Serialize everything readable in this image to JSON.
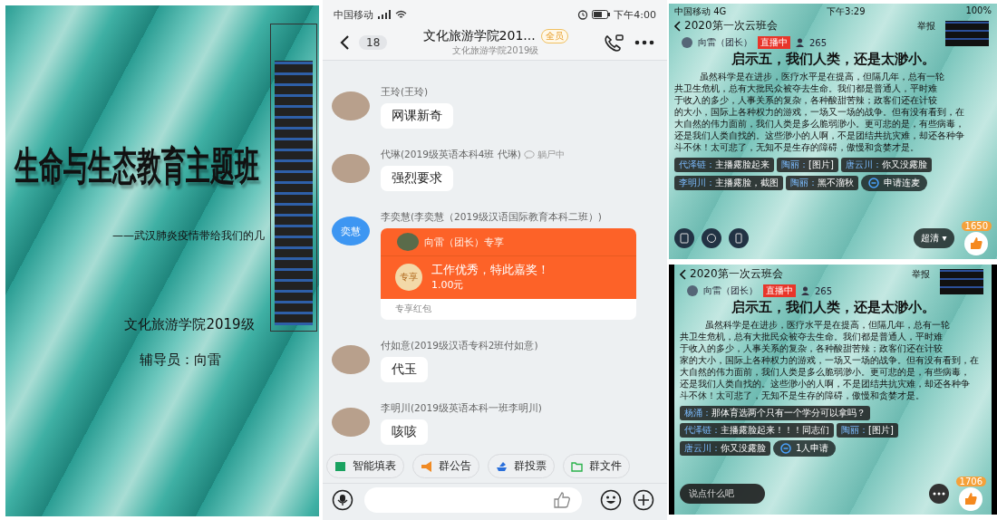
{
  "slide": {
    "title": "生命与生态教育主题班",
    "subtitle": "——武汉肺炎疫情带给我们的几",
    "college": "文化旅游学院2019级",
    "counselor": "辅导员：向雷"
  },
  "chat": {
    "status_bar": {
      "carrier": "中国移动",
      "time": "下午4:00"
    },
    "header": {
      "back_count": "18",
      "title": "文化旅游学院201...",
      "badge": "全员",
      "subtitle": "文化旅游学院2019级"
    },
    "messages": [
      {
        "kind": "text",
        "sender": "王玲(王玲)",
        "text": "网课新奇"
      },
      {
        "kind": "text",
        "sender": "代琳(2019级英语本科4班 代琳)",
        "status": "躺尸中",
        "text": "强烈要求"
      },
      {
        "kind": "red_packet",
        "sender": "李奕慧(李奕慧（2019级汉语国际教育本科二班）)",
        "avatar_text": "奕慧",
        "packet": {
          "from": "向雷（团长）专享",
          "badge": "专享",
          "wish": "工作优秀，特此嘉奖！",
          "amount": "1.00元",
          "footer": "专享红包"
        }
      },
      {
        "kind": "text",
        "sender": "付如意(2019级汉语专科2班付如意)",
        "text": "代玉"
      },
      {
        "kind": "text",
        "sender": "李明川(2019级英语本科一班李明川)",
        "text": "咳咳"
      }
    ],
    "quick_actions": [
      {
        "kind": "form",
        "label": "智能填表"
      },
      {
        "kind": "notice",
        "label": "群公告"
      },
      {
        "kind": "vote",
        "label": "群投票"
      },
      {
        "kind": "file",
        "label": "群文件"
      }
    ]
  },
  "streams": [
    {
      "status_bar": {
        "carrier": "中国移动",
        "network": "4G",
        "time": "下午3:29",
        "battery": "100%"
      },
      "title": "2020第一次云班会",
      "host": "向雷（团长）",
      "live_badge": "直播中",
      "viewers": "265",
      "report": "举报",
      "heading": "启示五，我们人类，还是太渺小。",
      "lines": [
        "虽然科学是在进步，医疗水平是在提高，但隔几年，总有一轮",
        "共卫生危机，总有大批民众被夺去生命。我们都是普通人，平时难",
        "于收入的多少，人事关系的复杂，各种酸甜苦辣；政客们还在计较",
        "的大小，国际上各种权力的游戏，一场又一场的战争。但有没有看到，在",
        "大自然的伟力面前，我们人类是多么脆弱渺小。更可悲的是，有些病毒，",
        "还是我们人类自找的。这些渺小的人啊，不是团结共抗灾难，却还各种争",
        "斗不休！太可悲了，无知不是生存的障碍，傲慢和贪婪才是。"
      ],
      "comments": [
        {
          "name": "代泽链：",
          "text": "主播露脸起来"
        },
        {
          "name": "陶丽：",
          "text": "[图片]"
        },
        {
          "name": "唐云川：",
          "text": "你又没露脸"
        },
        {
          "name": "李明川：",
          "text": "主播露脸，截图"
        },
        {
          "name": "陶丽：",
          "text": "黑不溜秋"
        }
      ],
      "connect": "申请连麦",
      "quality": "超清 ▾",
      "likes": "1650"
    },
    {
      "title": "2020第一次云班会",
      "host": "向雷（团长）",
      "live_badge": "直播中",
      "viewers": "265",
      "report": "举报",
      "heading": "启示五，我们人类，还是太渺小。",
      "lines": [
        "虽然科学是在进步，医疗水平是在提高，但隔几年，总有一轮",
        "共卫生危机，总有大批民众被夺去生命。我们都是普通人，平时难",
        "于收入的多少，人事关系的复杂，各种酸甜苦辣；政客们还在计较",
        "家的大小，国际上各种权力的游戏，一场又一场的战争。但有没有看到，在",
        "大自然的伟力面前，我们人类是多么脆弱渺小。更可悲的是，有些病毒，",
        "还是我们人类自找的。这些渺小的人啊，不是团结共抗灾难，却还各种争",
        "斗不休！太可悲了，无知不是生存的障碍，傲慢和贪婪才是。"
      ],
      "comments": [
        {
          "name": "杨涌：",
          "text": "那体育选两个只有一个学分可以拿吗？"
        },
        {
          "name": "代泽链：",
          "text": "主播露脸起来！！！同志们"
        },
        {
          "name": "陶丽：",
          "text": "[图片]"
        },
        {
          "name": "唐云川：",
          "text": "你又没露脸"
        }
      ],
      "connect": "1人申请",
      "comment_placeholder": "说点什么吧",
      "likes": "1706"
    }
  ]
}
